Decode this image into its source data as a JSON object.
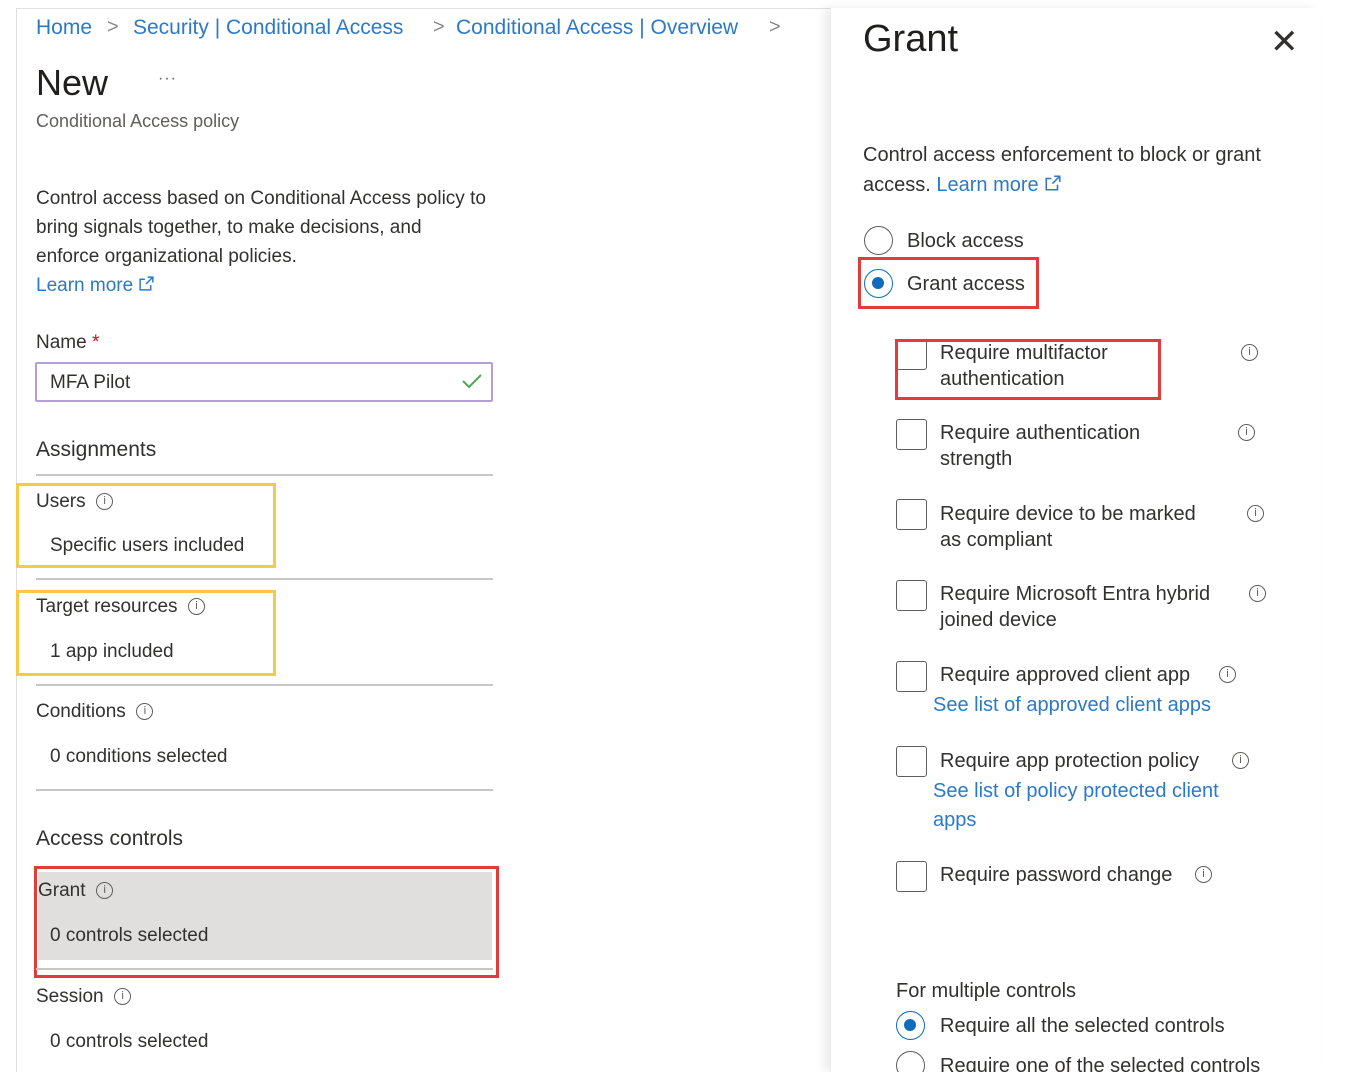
{
  "breadcrumb": {
    "items": [
      "Home",
      "Security | Conditional Access",
      "Conditional Access | Overview"
    ],
    "separator": ">"
  },
  "page": {
    "title": "New",
    "more": "···",
    "subtitle": "Conditional Access policy",
    "description": "Control access based on Conditional Access policy to bring signals together, to make decisions, and enforce organizational policies.",
    "learn_more": "Learn more"
  },
  "name_field": {
    "label": "Name",
    "required_mark": "*",
    "value": "MFA Pilot"
  },
  "assignments": {
    "heading": "Assignments",
    "users": {
      "label": "Users",
      "value": "Specific users included"
    },
    "target_resources": {
      "label": "Target resources",
      "value": "1 app included"
    },
    "conditions": {
      "label": "Conditions",
      "value": "0 conditions selected"
    }
  },
  "access_controls": {
    "heading": "Access controls",
    "grant": {
      "label": "Grant",
      "value": "0 controls selected"
    },
    "session": {
      "label": "Session",
      "value": "0 controls selected"
    }
  },
  "grant_panel": {
    "title": "Grant",
    "description": "Control access enforcement to block or grant access.",
    "learn_more": "Learn more",
    "block_access": "Block access",
    "grant_access": "Grant access",
    "selected_mode": "Grant access",
    "controls": [
      {
        "label": "Require multifactor authentication",
        "checked": false
      },
      {
        "label": "Require authentication strength",
        "checked": false
      },
      {
        "label": "Require device to be marked as compliant",
        "checked": false
      },
      {
        "label": "Require Microsoft Entra hybrid joined device",
        "checked": false
      },
      {
        "label": "Require approved client app",
        "link": "See list of approved client apps",
        "checked": false
      },
      {
        "label": "Require app protection policy",
        "link": "See list of policy protected client apps",
        "checked": false
      },
      {
        "label": "Require password change",
        "checked": false
      }
    ],
    "multiple_controls": {
      "label": "For multiple controls",
      "options": [
        "Require all the selected controls",
        "Require one of the selected controls"
      ],
      "selected": "Require all the selected controls"
    }
  },
  "colors": {
    "link": "#2b7ac9",
    "highlight_red": "#e33a3a",
    "highlight_yellow": "#f7c948",
    "radio_selected": "#0f6cbd",
    "valid_check": "#52a852"
  }
}
